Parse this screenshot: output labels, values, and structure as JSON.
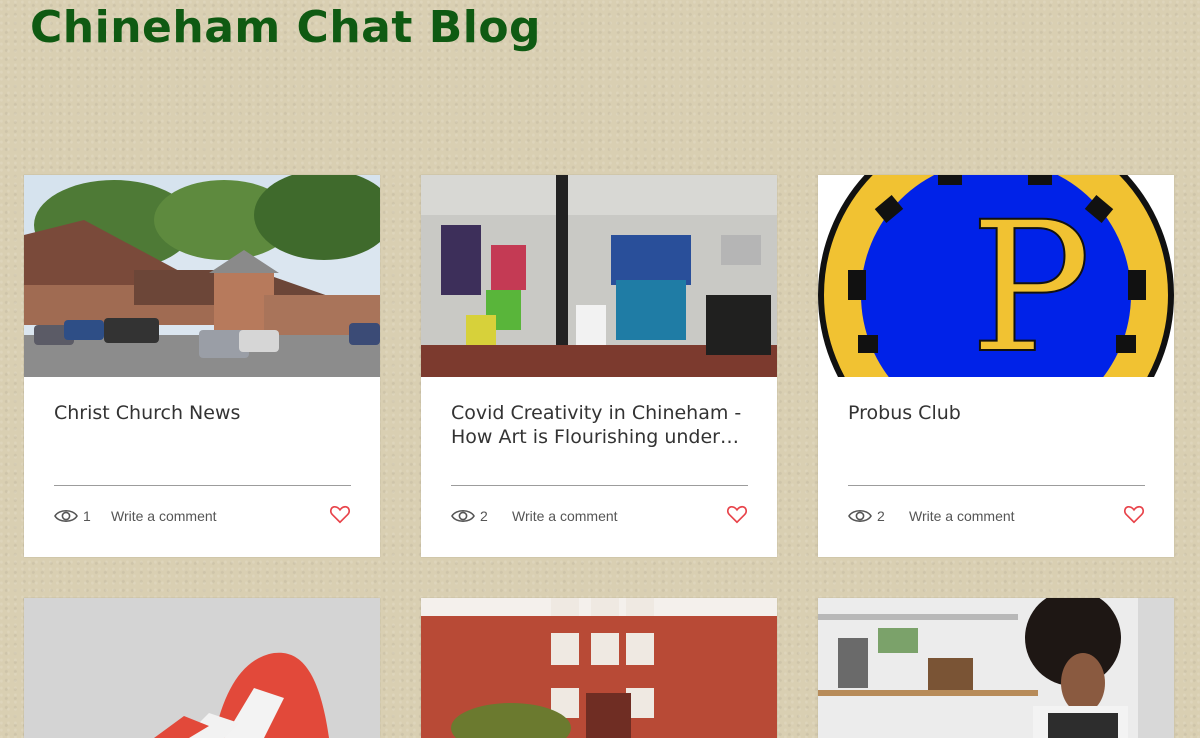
{
  "blog": {
    "title": "Chineham Chat Blog"
  },
  "posts": [
    {
      "title": "Christ Church News",
      "views": "1",
      "comment_label": "Write a comment"
    },
    {
      "title": "Covid Creativity in Chineham - How Art is Flourishing under…",
      "views": "2",
      "comment_label": "Write a comment"
    },
    {
      "title": "Probus Club",
      "views": "2",
      "comment_label": "Write a comment"
    }
  ],
  "icons": {
    "views": "eye-icon",
    "like": "heart-icon"
  },
  "colors": {
    "title": "#0f5a12",
    "heart": "#e8434a",
    "background": "#d9cfb2"
  }
}
